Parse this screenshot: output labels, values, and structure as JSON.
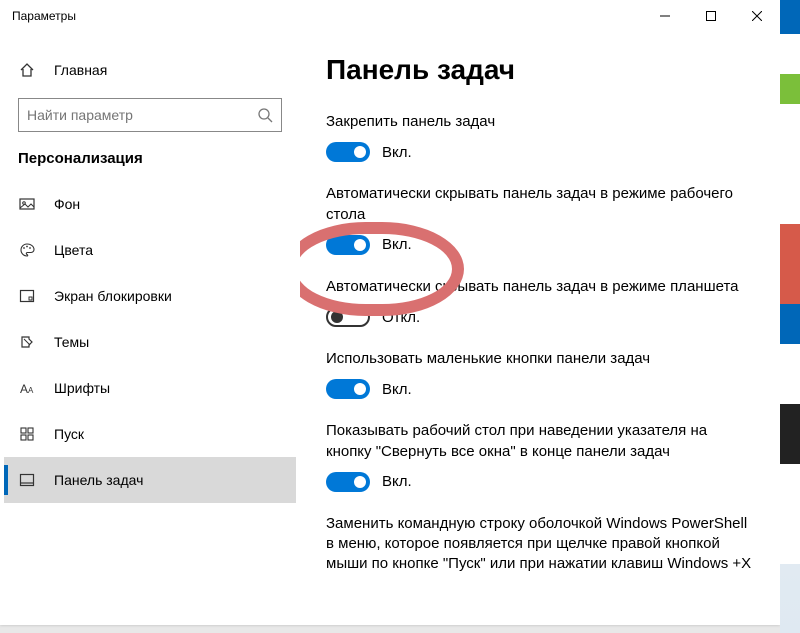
{
  "window": {
    "title": "Параметры"
  },
  "sidebar": {
    "home": "Главная",
    "search_placeholder": "Найти параметр",
    "category": "Персонализация",
    "items": [
      {
        "label": "Фон"
      },
      {
        "label": "Цвета"
      },
      {
        "label": "Экран блокировки"
      },
      {
        "label": "Темы"
      },
      {
        "label": "Шрифты"
      },
      {
        "label": "Пуск"
      },
      {
        "label": "Панель задач"
      }
    ]
  },
  "content": {
    "heading": "Панель задач",
    "options": [
      {
        "label": "Закрепить панель задач",
        "state": "Вкл.",
        "on": true
      },
      {
        "label": "Автоматически скрывать панель задач в режиме рабочего стола",
        "state": "Вкл.",
        "on": true
      },
      {
        "label": "Автоматически скрывать панель задач в режиме планшета",
        "state": "Откл.",
        "on": false
      },
      {
        "label": "Использовать маленькие кнопки панели задач",
        "state": "Вкл.",
        "on": true
      },
      {
        "label": "Показывать рабочий стол при наведении указателя на кнопку \"Свернуть все окна\" в конце панели задач",
        "state": "Вкл.",
        "on": true
      },
      {
        "label": "Заменить командную строку оболочкой Windows PowerShell в меню, которое появляется при щелчке правой кнопкой мыши по кнопке \"Пуск\" или при нажатии клавиш Windows +X",
        "state": "",
        "on": null
      }
    ]
  }
}
